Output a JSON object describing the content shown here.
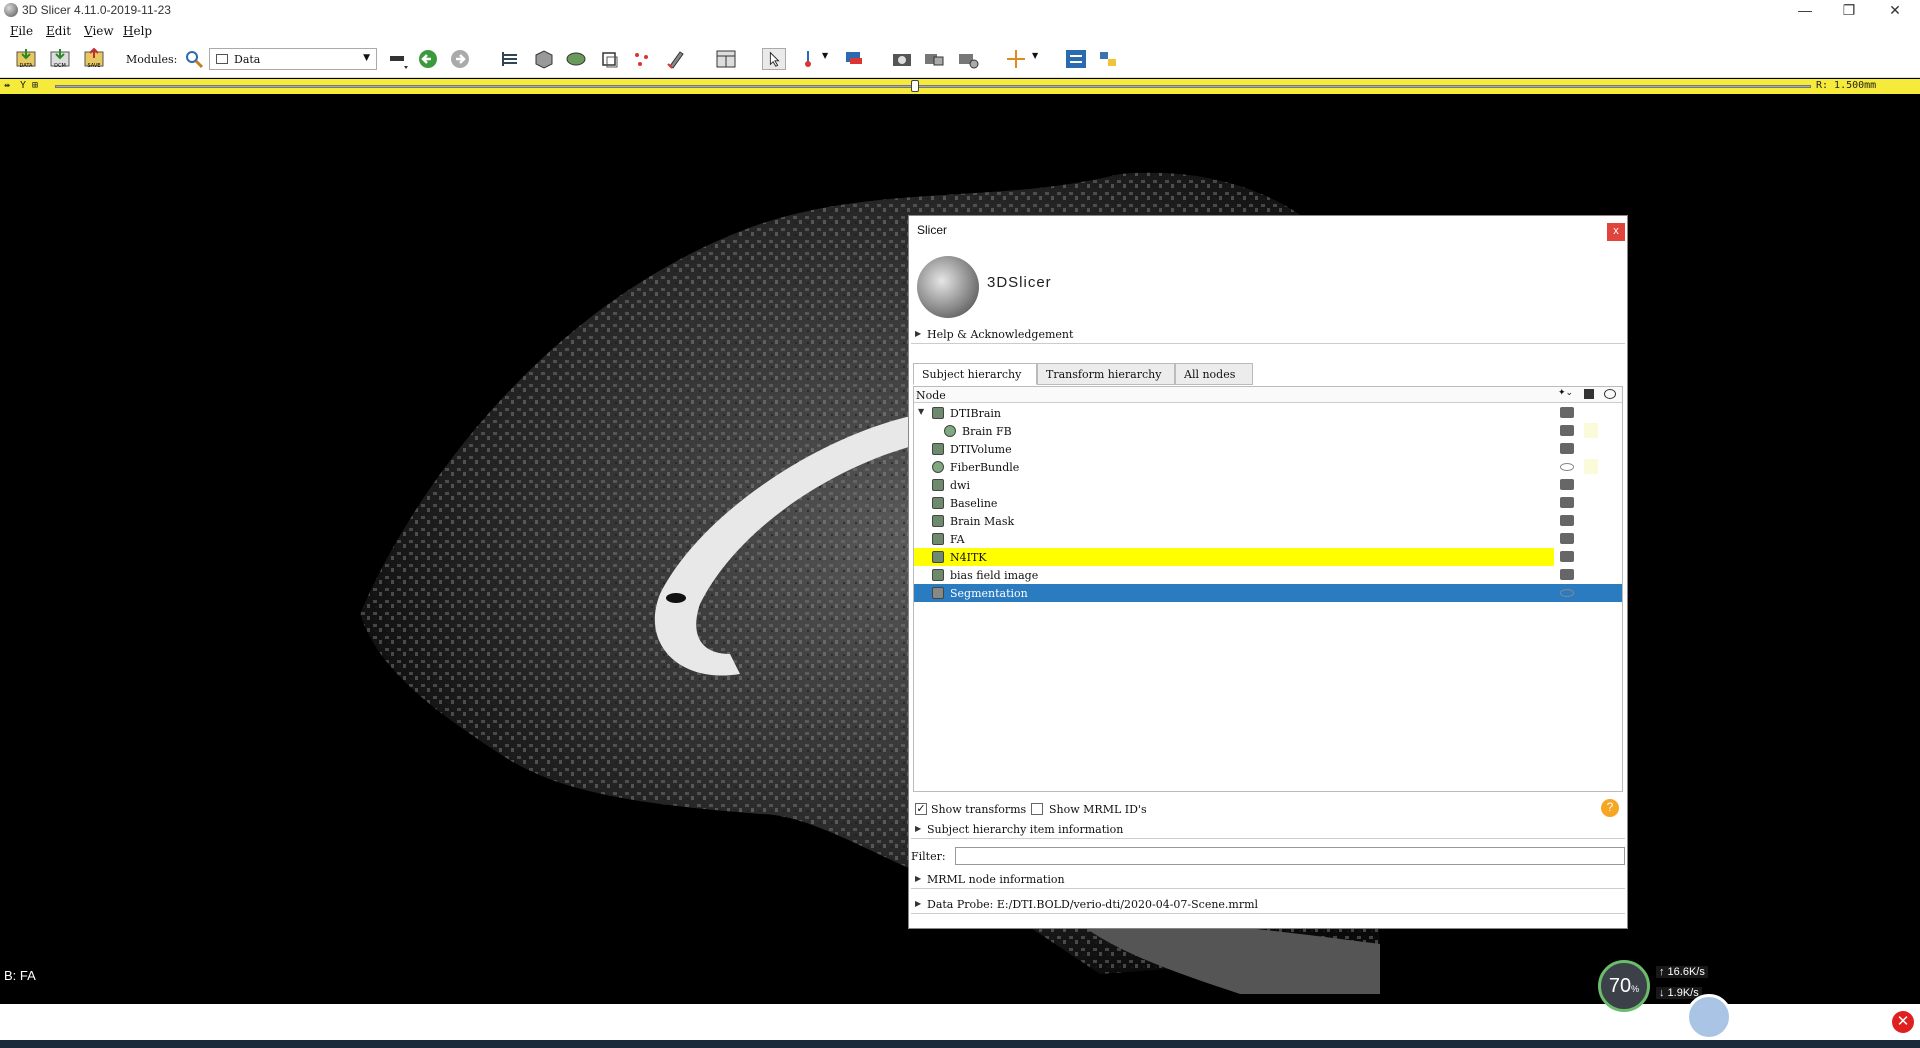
{
  "window": {
    "title": "3D Slicer 4.11.0-2019-11-23",
    "controls": [
      "—",
      "❐",
      "✕"
    ]
  },
  "menu": {
    "items": [
      {
        "key": "F",
        "rest": "ile"
      },
      {
        "key": "E",
        "rest": "dit"
      },
      {
        "key": "V",
        "rest": "iew"
      },
      {
        "key": "H",
        "rest": "elp"
      }
    ]
  },
  "toolbar": {
    "data_label": "DATA",
    "dcm_label": "DCM",
    "save_label": "SAVE",
    "modules_label": "Modules:",
    "module_selected": "Data"
  },
  "slice": {
    "left_label": "Y",
    "right_label": "R: 1.500mm",
    "position_fraction": 0.49
  },
  "viewer": {
    "label": "B: FA"
  },
  "net": {
    "percent": "70",
    "percent_unit": "%",
    "up": "↑ 16.6K/s",
    "down": "↓ 1.9K/s"
  },
  "dialog": {
    "title": "Slicer",
    "logo_text": "3DSlicer",
    "help_section": "Help & Acknowledgement",
    "tabs": [
      "Subject hierarchy",
      "Transform hierarchy",
      "All nodes"
    ],
    "tree_header": "Node",
    "nodes": [
      {
        "label": "DTIBrain",
        "level": 0,
        "expanded": true,
        "icon": "volume-icon",
        "visibility": "icon",
        "swatch": false,
        "state": ""
      },
      {
        "label": "Brain FB",
        "level": 1,
        "icon": "fiber-icon",
        "visibility": "icon",
        "swatch": true,
        "state": ""
      },
      {
        "label": "DTIVolume",
        "level": 0,
        "icon": "volume-icon",
        "visibility": "icon",
        "swatch": false,
        "state": ""
      },
      {
        "label": "FiberBundle",
        "level": 0,
        "icon": "fiber-icon",
        "visibility": "eye",
        "swatch": true,
        "state": ""
      },
      {
        "label": "dwi",
        "level": 0,
        "icon": "volume-icon",
        "visibility": "icon",
        "swatch": false,
        "state": ""
      },
      {
        "label": "Baseline",
        "level": 0,
        "icon": "volume-icon",
        "visibility": "icon",
        "swatch": false,
        "state": ""
      },
      {
        "label": "Brain Mask",
        "level": 0,
        "icon": "volume-icon",
        "visibility": "icon",
        "swatch": false,
        "state": ""
      },
      {
        "label": "FA",
        "level": 0,
        "icon": "volume-icon",
        "visibility": "icon",
        "swatch": false,
        "state": ""
      },
      {
        "label": "N4ITK",
        "level": 0,
        "icon": "volume-icon",
        "visibility": "icon",
        "swatch": false,
        "state": "yellow"
      },
      {
        "label": "bias field image",
        "level": 0,
        "icon": "volume-icon",
        "visibility": "icon",
        "swatch": false,
        "state": ""
      },
      {
        "label": "Segmentation",
        "level": 0,
        "icon": "segmentation-icon",
        "visibility": "eye",
        "swatch": false,
        "state": "selected"
      }
    ],
    "show_transforms_label": "Show transforms",
    "show_transforms_checked": true,
    "show_mrml_ids_label": "Show MRML ID's",
    "show_mrml_ids_checked": false,
    "item_info_section": "Subject hierarchy item information",
    "filter_label": "Filter:",
    "filter_value": "",
    "mrml_section": "MRML node information",
    "data_probe": "Data Probe: E:/DTI.BOLD/verio-dti/2020-04-07-Scene.mrml"
  },
  "colors": {
    "slice_bar": "#f6ea3a",
    "selection": "#2b7bc0",
    "highlight": "#ffff00"
  }
}
